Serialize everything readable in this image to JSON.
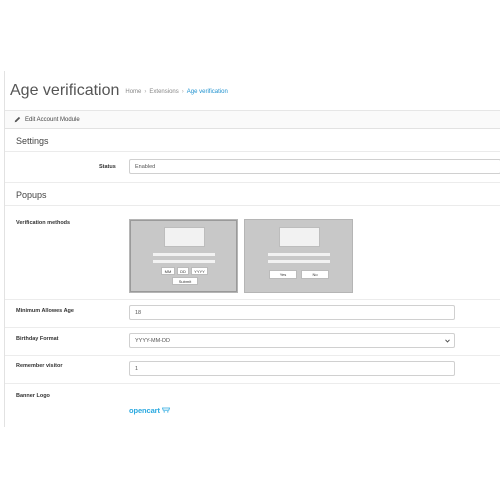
{
  "header": {
    "title": "Age verification",
    "breadcrumb": [
      "Home",
      "Extensions",
      "Age verification"
    ],
    "breadcrumb_separator": "›"
  },
  "panel": {
    "heading": "Edit Account Module",
    "icon": "pencil-icon"
  },
  "settings": {
    "title": "Settings",
    "status_label": "Status",
    "status_value": "Enabled"
  },
  "popups": {
    "title": "Popups",
    "verification_label": "Verification methods",
    "method_date": {
      "mm": "MM",
      "dd": "DD",
      "yyyy": "YYYY",
      "submit": "Submit"
    },
    "method_yesno": {
      "yes": "Yes",
      "no": "No"
    },
    "min_age_label": "Minimum Allowes Age",
    "min_age_value": "18",
    "birthday_format_label": "Birthday Format",
    "birthday_format_value": "YYYY-MM-DD",
    "remember_label": "Remember visitor",
    "remember_value": "1",
    "banner_logo_label": "Banner Logo",
    "banner_logo_text": "opencart"
  },
  "colors": {
    "accent": "#1e91cf",
    "logo": "#2aa9e0"
  }
}
